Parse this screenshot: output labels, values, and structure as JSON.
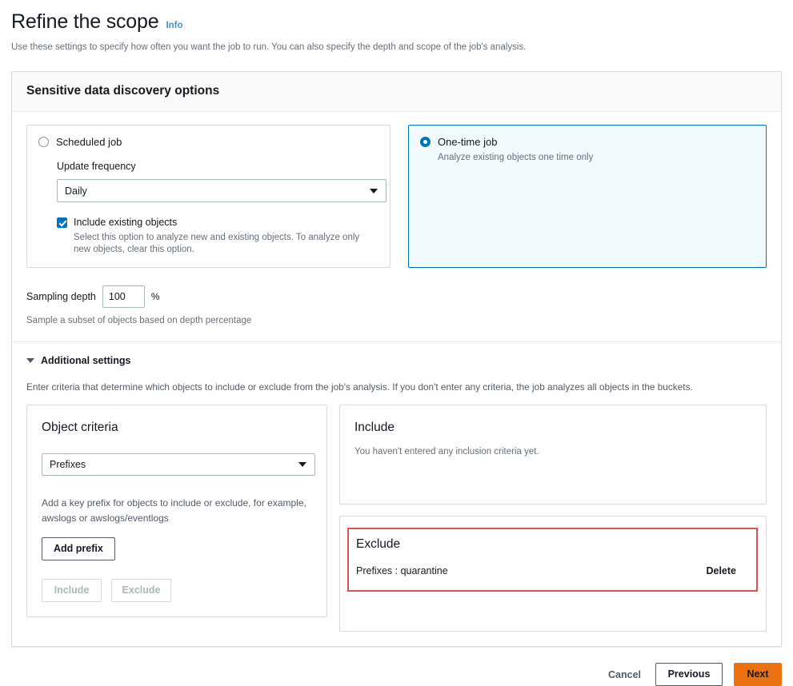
{
  "page": {
    "title": "Refine the scope",
    "info_label": "Info",
    "subtitle": "Use these settings to specify how often you want the job to run. You can also specify the depth and scope of the job's analysis."
  },
  "discovery": {
    "header": "Sensitive data discovery options",
    "scheduled": {
      "label": "Scheduled job",
      "selected": false,
      "frequency_label": "Update frequency",
      "frequency_value": "Daily",
      "include_existing_label": "Include existing objects",
      "include_existing_checked": true,
      "include_existing_desc": "Select this option to analyze new and existing objects. To analyze only new objects, clear this option."
    },
    "onetime": {
      "label": "One-time job",
      "selected": true,
      "desc": "Analyze existing objects one time only"
    },
    "sampling": {
      "label": "Sampling depth",
      "value": "100",
      "unit": "%",
      "hint": "Sample a subset of objects based on depth percentage"
    }
  },
  "additional": {
    "expander_label": "Additional settings",
    "expanded": true,
    "intro": "Enter criteria that determine which objects to include or exclude from the job's analysis. If you don't enter any criteria, the job analyzes all objects in the buckets.",
    "object_criteria": {
      "title": "Object criteria",
      "type_value": "Prefixes",
      "hint": "Add a key prefix for objects to include or exclude, for example, awslogs or awslogs/eventlogs",
      "add_button": "Add prefix",
      "include_button": "Include",
      "exclude_button": "Exclude",
      "include_disabled": true,
      "exclude_disabled": true
    },
    "include_panel": {
      "title": "Include",
      "empty_text": "You haven't entered any inclusion criteria yet."
    },
    "exclude_panel": {
      "title": "Exclude",
      "entry_text": "Prefixes : quarantine",
      "delete_label": "Delete",
      "highlight_color": "#d9534f"
    }
  },
  "footer": {
    "cancel": "Cancel",
    "previous": "Previous",
    "next": "Next",
    "next_color": "#ec7211"
  }
}
